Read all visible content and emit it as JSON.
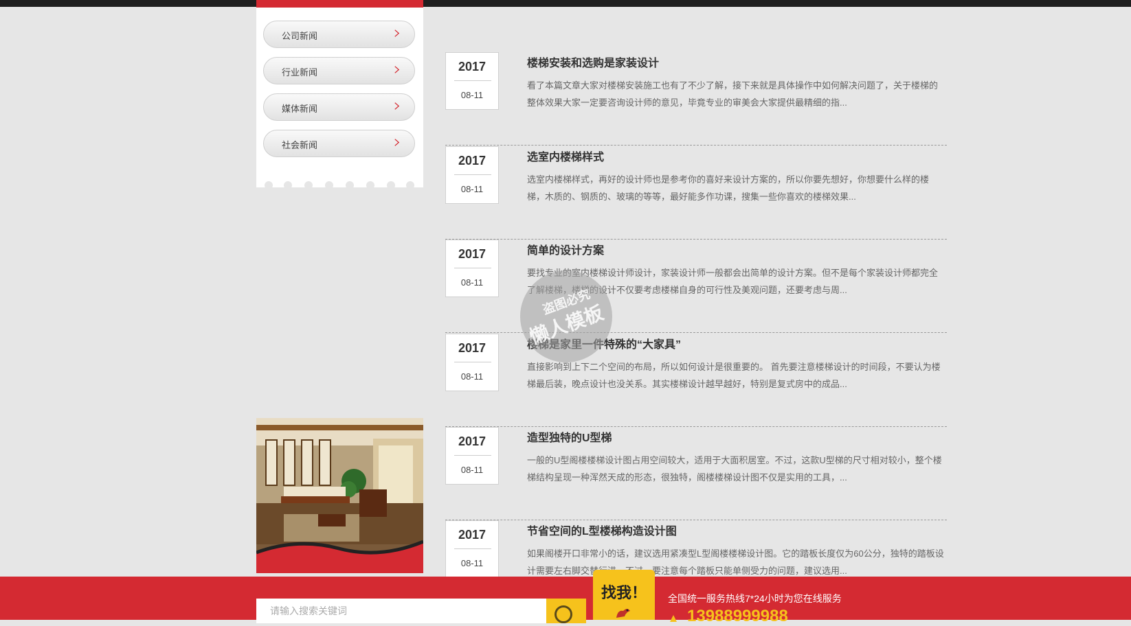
{
  "sidebar": {
    "items": [
      {
        "label": "公司新闻"
      },
      {
        "label": "行业新闻"
      },
      {
        "label": "媒体新闻"
      },
      {
        "label": "社会新闻"
      }
    ]
  },
  "news": [
    {
      "year": "2017",
      "date": "08-11",
      "title": "楼梯安装和选购是家装设计",
      "desc": "看了本篇文章大家对楼梯安装施工也有了不少了解，接下来就是具体操作中如何解决问题了，关于楼梯的整体效果大家一定要咨询设计师的意见，毕竟专业的审美会大家提供最精细的指..."
    },
    {
      "year": "2017",
      "date": "08-11",
      "title": "选室内楼梯样式",
      "desc": "选室内楼梯样式，再好的设计师也是参考你的喜好来设计方案的，所以你要先想好，你想要什么样的楼梯，木质的、钢质的、玻璃的等等，最好能多作功课，搜集一些你喜欢的楼梯效果..."
    },
    {
      "year": "2017",
      "date": "08-11",
      "title": "简单的设计方案",
      "desc": "要找专业的室内楼梯设计师设计，家装设计师一般都会出简单的设计方案。但不是每个家装设计师都完全了解楼梯，楼梯的设计不仅要考虑楼梯自身的可行性及美观问题，还要考虑与周..."
    },
    {
      "year": "2017",
      "date": "08-11",
      "title": "楼梯是家里一件特殊的“大家具”",
      "desc": "直接影响到上下二个空间的布局，所以如何设计是很重要的。 首先要注意楼梯设计的时间段，不要认为楼梯最后装，晚点设计也没关系。其实楼梯设计越早越好，特别是复式房中的成品..."
    },
    {
      "year": "2017",
      "date": "08-11",
      "title": "造型独特的U型梯",
      "desc": "一般的U型阁楼楼梯设计图占用空间较大，适用于大面积居室。不过，这款U型梯的尺寸相对较小，整个楼梯结构呈现一种浑然天成的形态，很独特，阁楼楼梯设计图不仅是实用的工具，..."
    },
    {
      "year": "2017",
      "date": "08-11",
      "title": "节省空间的L型楼梯构造设计图",
      "desc": "如果阁楼开口非常小的话，建议选用紧凑型L型阁楼楼梯设计图。它的踏板长度仅为60公分，独特的踏板设计需要左右脚交替行进。不过，要注意每个踏板只能单侧受力的问题，建议选用..."
    }
  ],
  "watermark": {
    "line1": "盗图必究",
    "line2": "懒人模板"
  },
  "footer": {
    "search_placeholder": "请输入搜索关键词",
    "findme": "找我！",
    "hotline_label": "全国统一服务热线7*24小时为您在线服务",
    "hotline_number": "13988999988"
  },
  "colors": {
    "accent": "#d42a32",
    "yellow": "#f6c21c",
    "background": "#e6e6e6"
  }
}
